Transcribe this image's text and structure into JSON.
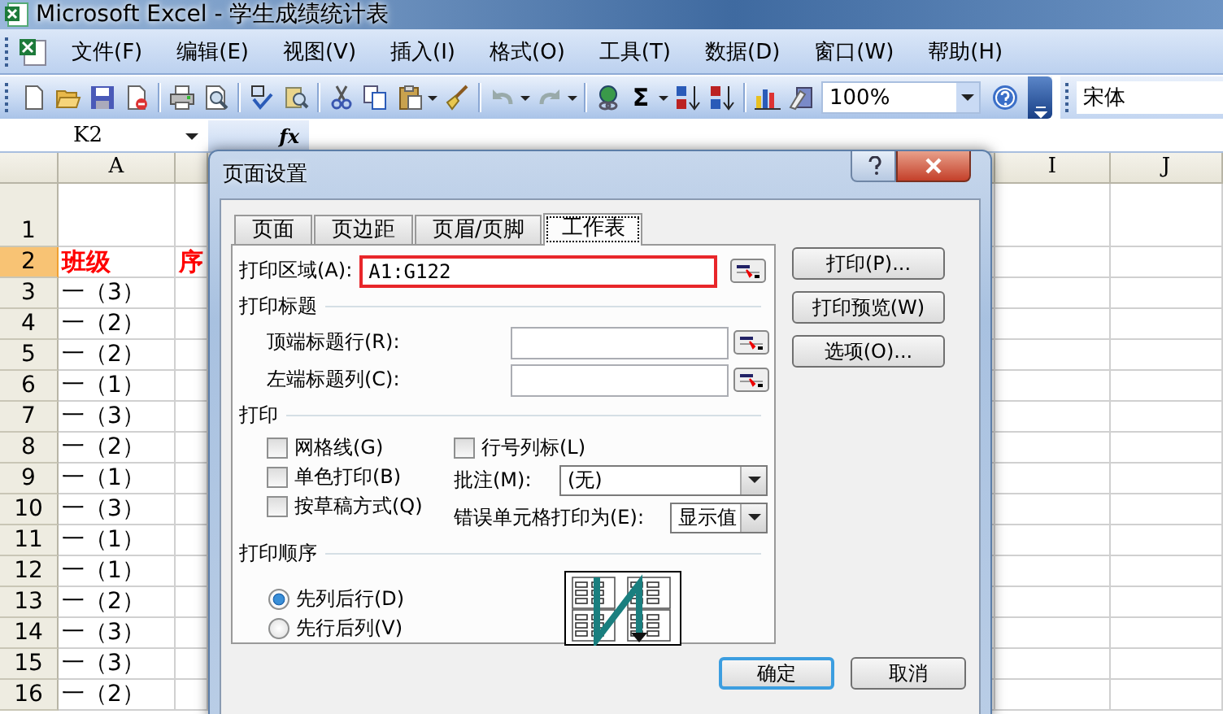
{
  "window": {
    "title": "Microsoft Excel - 学生成绩统计表"
  },
  "menu": [
    "文件(F)",
    "编辑(E)",
    "视图(V)",
    "插入(I)",
    "格式(O)",
    "工具(T)",
    "数据(D)",
    "窗口(W)",
    "帮助(H)"
  ],
  "toolbar": {
    "sum": "Σ",
    "zoom": "100%",
    "font": "宋体"
  },
  "formula_bar": {
    "name_box": "K2",
    "function_label": "fx"
  },
  "sheet": {
    "columns": [
      "A",
      "I",
      "J"
    ],
    "rows": [
      {
        "number": "1",
        "selected": false,
        "kind": "data",
        "cells": []
      },
      {
        "number": "2",
        "selected": true,
        "kind": "header",
        "cells": [
          "班级",
          "序"
        ]
      },
      {
        "number": "3",
        "selected": false,
        "kind": "data",
        "cells": [
          "一（3）"
        ]
      },
      {
        "number": "4",
        "selected": false,
        "kind": "data",
        "cells": [
          "一（2）"
        ]
      },
      {
        "number": "5",
        "selected": false,
        "kind": "data",
        "cells": [
          "一（2）"
        ]
      },
      {
        "number": "6",
        "selected": false,
        "kind": "data",
        "cells": [
          "一（1）"
        ]
      },
      {
        "number": "7",
        "selected": false,
        "kind": "data",
        "cells": [
          "一（3）"
        ]
      },
      {
        "number": "8",
        "selected": false,
        "kind": "data",
        "cells": [
          "一（2）"
        ]
      },
      {
        "number": "9",
        "selected": false,
        "kind": "data",
        "cells": [
          "一（1）"
        ]
      },
      {
        "number": "10",
        "selected": false,
        "kind": "data",
        "cells": [
          "一（3）"
        ]
      },
      {
        "number": "11",
        "selected": false,
        "kind": "data",
        "cells": [
          "一（1）"
        ]
      },
      {
        "number": "12",
        "selected": false,
        "kind": "data",
        "cells": [
          "一（1）"
        ]
      },
      {
        "number": "13",
        "selected": false,
        "kind": "data",
        "cells": [
          "一（2）"
        ]
      },
      {
        "number": "14",
        "selected": false,
        "kind": "data",
        "cells": [
          "一（3）"
        ]
      },
      {
        "number": "15",
        "selected": false,
        "kind": "data",
        "cells": [
          "一（3）"
        ]
      },
      {
        "number": "16",
        "selected": false,
        "kind": "data",
        "cells": [
          "一（2）"
        ]
      }
    ]
  },
  "dialog": {
    "title": "页面设置",
    "tabs": [
      {
        "label": "页面",
        "selected": false
      },
      {
        "label": "页边距",
        "selected": false
      },
      {
        "label": "页眉/页脚",
        "selected": false
      },
      {
        "label": "工作表",
        "selected": true
      }
    ],
    "print_area": {
      "label": "打印区域(A):",
      "value": "A1:G122",
      "highlighted": true
    },
    "print_titles": {
      "heading": "打印标题",
      "fields": [
        {
          "label": "顶端标题行(R):"
        },
        {
          "label": "左端标题列(C):"
        }
      ]
    },
    "print": {
      "heading": "打印",
      "options": [
        {
          "label": "网格线(G)",
          "checked": false
        },
        {
          "label": "单色打印(B)",
          "checked": false
        },
        {
          "label": "按草稿方式(Q)",
          "checked": false
        },
        {
          "label": "行号列标(L)",
          "checked": false
        }
      ],
      "comments": {
        "label": "批注(M):",
        "value": "(无)"
      },
      "errors": {
        "label": "错误单元格打印为(E):",
        "value": "显示值"
      }
    },
    "page_order": {
      "heading": "打印顺序",
      "options": [
        {
          "label": "先列后行(D)",
          "selected": true
        },
        {
          "label": "先行后列(V)",
          "selected": false
        }
      ]
    },
    "side_buttons": [
      "打印(P)...",
      "打印预览(W)",
      "选项(O)..."
    ],
    "footer_buttons": [
      {
        "label": "确定",
        "focused": true
      },
      {
        "label": "取消",
        "focused": false
      }
    ]
  }
}
